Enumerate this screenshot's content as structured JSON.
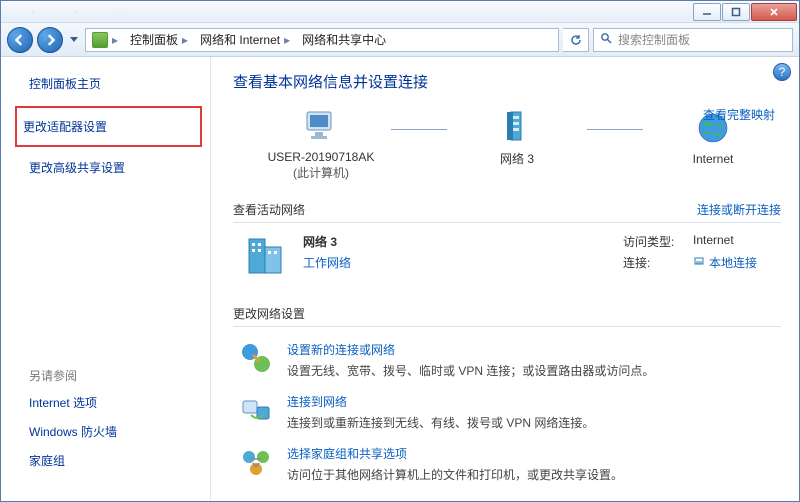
{
  "breadcrumb": {
    "root_icon": "control-panel-icon",
    "items": [
      "控制面板",
      "网络和 Internet",
      "网络和共享中心"
    ]
  },
  "search": {
    "placeholder": "搜索控制面板"
  },
  "sidebar": {
    "home": "控制面板主页",
    "links": [
      "更改适配器设置",
      "更改高级共享设置"
    ],
    "see_also_label": "另请参阅",
    "see_also": [
      "Internet 选项",
      "Windows 防火墙",
      "家庭组"
    ]
  },
  "main": {
    "heading": "查看基本网络信息并设置连接",
    "full_map_link": "查看完整映射",
    "map": {
      "node1": {
        "name": "USER-20190718AK",
        "sub": "(此计算机)"
      },
      "node2": {
        "name": "网络  3"
      },
      "node3": {
        "name": "Internet"
      }
    },
    "active_section": {
      "title": "查看活动网络",
      "right_link": "连接或断开连接",
      "network_name": "网络  3",
      "network_type": "工作网络",
      "access_label": "访问类型:",
      "access_value": "Internet",
      "conn_label": "连接:",
      "conn_value": "本地连接"
    },
    "change_section": {
      "title": "更改网络设置"
    },
    "settings": [
      {
        "title": "设置新的连接或网络",
        "desc": "设置无线、宽带、拨号、临时或 VPN 连接；或设置路由器或访问点。"
      },
      {
        "title": "连接到网络",
        "desc": "连接到或重新连接到无线、有线、拨号或 VPN 网络连接。"
      },
      {
        "title": "选择家庭组和共享选项",
        "desc": "访问位于其他网络计算机上的文件和打印机，或更改共享设置。"
      }
    ]
  }
}
